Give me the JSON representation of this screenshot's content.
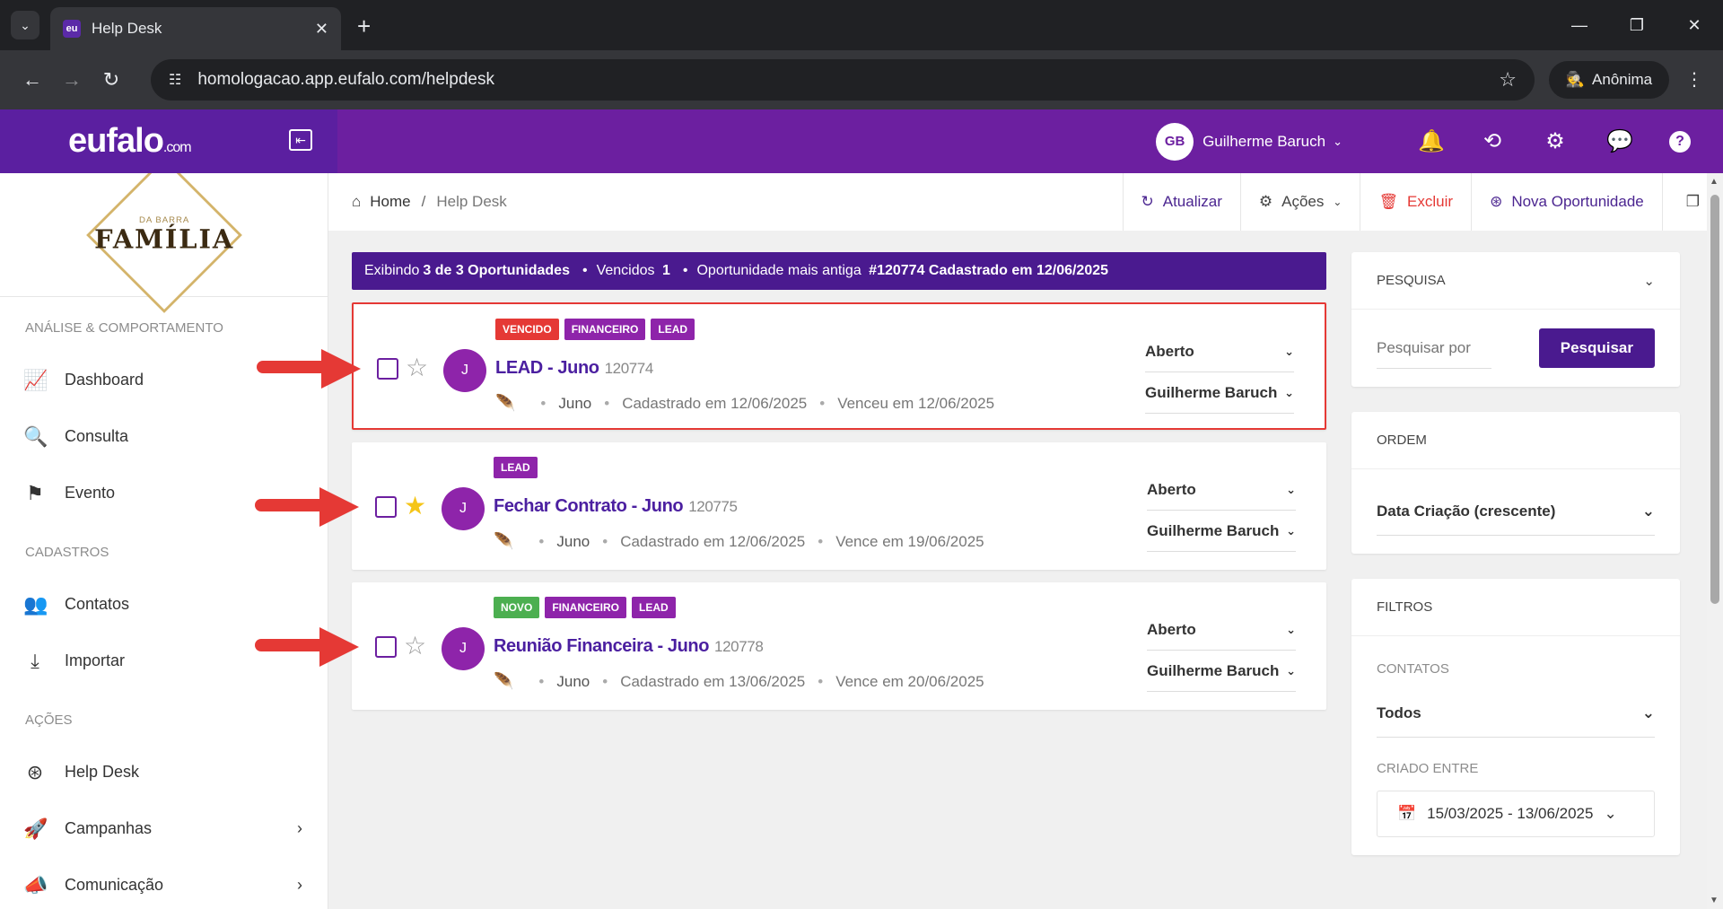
{
  "browser": {
    "tab_title": "Help Desk",
    "favicon_text": "eu",
    "url": "homologacao.app.eufalo.com/helpdesk",
    "incognito_label": "Anônima"
  },
  "header": {
    "logo_main": "eufalo",
    "logo_suffix": ".com",
    "user_initials": "GB",
    "user_name": "Guilherme Baruch"
  },
  "brand": {
    "small": "DA BARRA",
    "big": "FAMÍLIA"
  },
  "sidebar": {
    "sections": [
      {
        "title": "ANÁLISE & COMPORTAMENTO",
        "items": [
          {
            "label": "Dashboard",
            "icon": "chart-area-icon"
          },
          {
            "label": "Consulta",
            "icon": "search-icon"
          },
          {
            "label": "Evento",
            "icon": "flag-icon"
          }
        ]
      },
      {
        "title": "CADASTROS",
        "items": [
          {
            "label": "Contatos",
            "icon": "contacts-icon"
          },
          {
            "label": "Importar",
            "icon": "download-icon"
          }
        ]
      },
      {
        "title": "AÇÕES",
        "items": [
          {
            "label": "Help Desk",
            "icon": "lifebuoy-icon"
          },
          {
            "label": "Campanhas",
            "icon": "rocket-icon"
          },
          {
            "label": "Comunicação",
            "icon": "megaphone-icon"
          }
        ]
      }
    ]
  },
  "breadcrumb": {
    "home": "Home",
    "sep": "/",
    "current": "Help Desk"
  },
  "toolbar": {
    "refresh": "Atualizar",
    "actions": "Ações",
    "delete": "Excluir",
    "new": "Nova Oportunidade"
  },
  "summary": {
    "prefix": "Exibindo",
    "count": "3 de 3 Oportunidades",
    "overdue_label": "Vencidos",
    "overdue_count": "1",
    "oldest_label": "Oportunidade mais antiga",
    "oldest_value": "#120774 Cadastrado em 12/06/2025"
  },
  "cards": [
    {
      "badges": [
        {
          "text": "VENCIDO",
          "color": "red"
        },
        {
          "text": "FINANCEIRO",
          "color": "purple"
        },
        {
          "text": "LEAD",
          "color": "purple"
        }
      ],
      "title": "LEAD - Juno",
      "num": "120774",
      "avatar": "J",
      "starred": false,
      "owner": "Juno",
      "created": "Cadastrado em 12/06/2025",
      "due": "Venceu em 12/06/2025",
      "status": "Aberto",
      "assignee": "Guilherme Baruch",
      "highlight": true
    },
    {
      "badges": [
        {
          "text": "LEAD",
          "color": "purple"
        }
      ],
      "title": "Fechar Contrato - Juno",
      "num": "120775",
      "avatar": "J",
      "starred": true,
      "owner": "Juno",
      "created": "Cadastrado em 12/06/2025",
      "due": "Vence em 19/06/2025",
      "status": "Aberto",
      "assignee": "Guilherme Baruch",
      "highlight": false
    },
    {
      "badges": [
        {
          "text": "NOVO",
          "color": "green"
        },
        {
          "text": "FINANCEIRO",
          "color": "purple"
        },
        {
          "text": "LEAD",
          "color": "purple"
        }
      ],
      "title": "Reunião Financeira - Juno",
      "num": "120778",
      "avatar": "J",
      "starred": false,
      "owner": "Juno",
      "created": "Cadastrado em 13/06/2025",
      "due": "Vence em 20/06/2025",
      "status": "Aberto",
      "assignee": "Guilherme Baruch",
      "highlight": false
    }
  ],
  "panels": {
    "search": {
      "title": "PESQUISA",
      "placeholder": "Pesquisar por",
      "button": "Pesquisar"
    },
    "order": {
      "title": "ORDEM",
      "value": "Data Criação (crescente)"
    },
    "filters": {
      "title": "FILTROS",
      "contacts_label": "CONTATOS",
      "contacts_value": "Todos",
      "created_label": "CRIADO ENTRE",
      "created_value": "15/03/2025 - 13/06/2025"
    }
  },
  "colors": {
    "brand_purple": "#6c1fa0",
    "dark_purple": "#4a1a8f",
    "alert_red": "#e53935",
    "success_green": "#4caf50"
  }
}
